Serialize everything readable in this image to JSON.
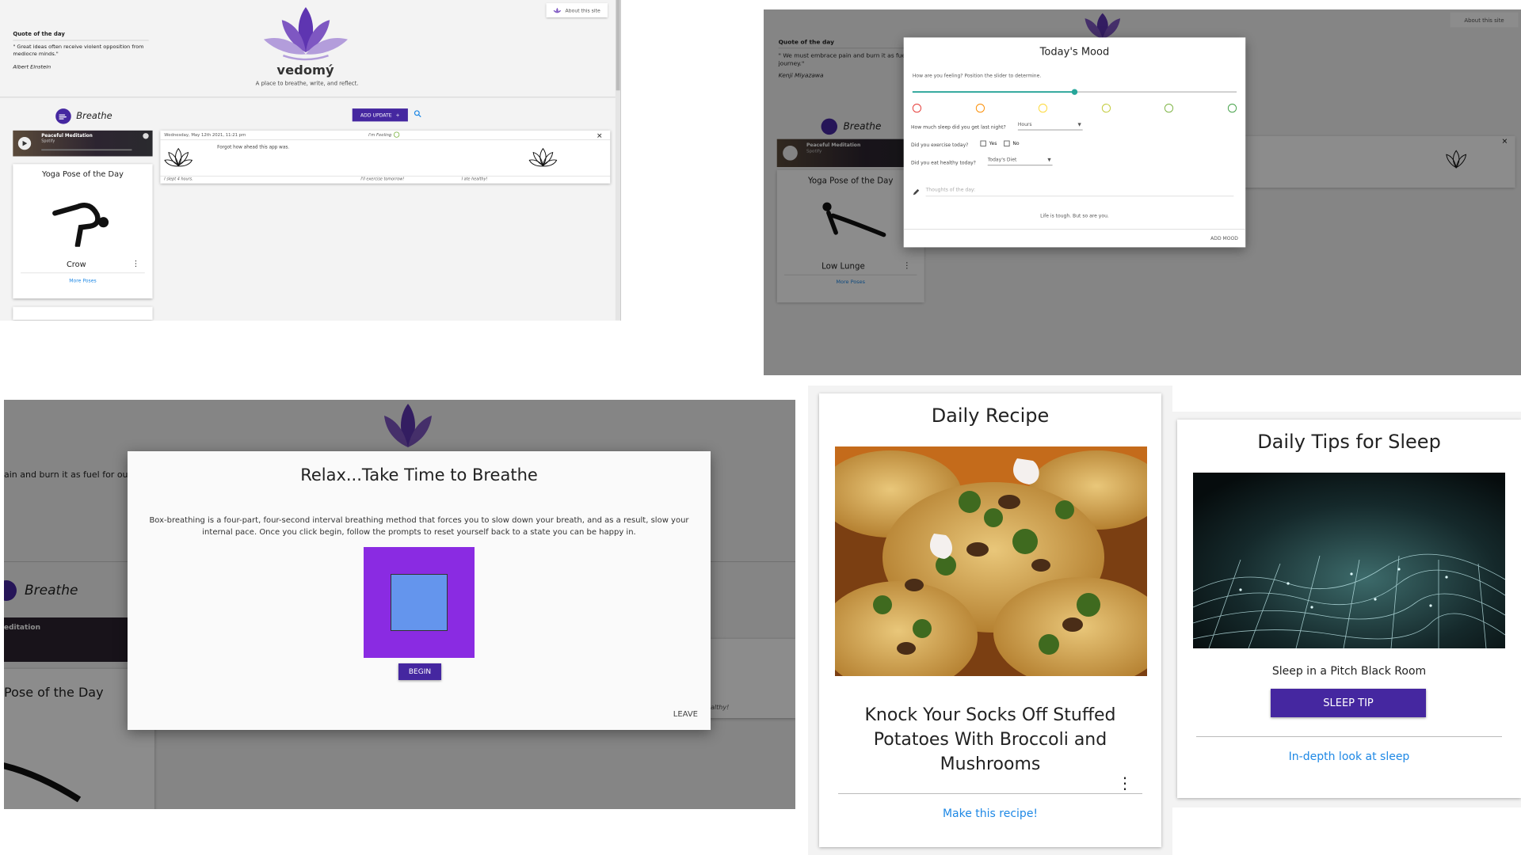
{
  "app": {
    "site_name": "vedomý",
    "tagline": "A place to breathe, write, and reflect.",
    "about_label": "About this site"
  },
  "quote": {
    "title": "Quote of the day",
    "text": "\" Great ideas often receive violent opposition from mediocre minds.\"",
    "author": "Albert Einstein"
  },
  "quote2": {
    "title": "Quote of the day",
    "text": "\" We must embrace pain and burn it as fuel for our journey.\"",
    "author": "Kenji Miyazawa"
  },
  "breathe": {
    "label": "Breathe"
  },
  "toolbar": {
    "add_update_label": "ADD UPDATE"
  },
  "player": {
    "title": "Peaceful Meditation",
    "source": "Spotify"
  },
  "yoga1": {
    "title": "Yoga Pose of the Day",
    "pose": "Crow",
    "link": "More Poses"
  },
  "yoga2": {
    "title": "Yoga Pose of the Day",
    "pose": "Low Lunge",
    "link": "More Poses"
  },
  "entry": {
    "date": "Wednesday, May 12th 2021, 11:21 pm",
    "feeling_label": "I'm Feeling",
    "text": "Forgot how ahead this app was.",
    "slept": "I slept 4 hours.",
    "exercise": "I'll exercise tomorrow!",
    "healthy": "I ate healthy!"
  },
  "mood_modal": {
    "title": "Today's Mood",
    "slider_prompt": "How are you feeling? Position the slider to determine.",
    "slider_value": 0.5,
    "sleep_question": "How much sleep did you get last night?",
    "sleep_value": "Hours",
    "exercise_question": "Did you exercise today?",
    "exercise_yes": "Yes",
    "exercise_no": "No",
    "diet_question": "Did you eat healthy today?",
    "diet_value": "Today's Diet",
    "thoughts_placeholder": "Thoughts of the day:",
    "footer_text": "Life is tough. But so are you.",
    "add_mood_label": "ADD MOOD",
    "face_colors": [
      "#e53935",
      "#fb8c00",
      "#fdd835",
      "#c0ca33",
      "#7cb342",
      "#43a047"
    ]
  },
  "breathe_modal": {
    "title": "Relax...Take Time to Breathe",
    "description": "Box-breathing is a four-part, four-second interval breathing method that forces you to slow down your breath, and as a result, slow your internal pace. Once you click begin, follow the prompts to reset yourself back to a state you can be happy in.",
    "begin_label": "BEGIN",
    "leave_label": "LEAVE",
    "bg_fragment_quote": "ain and burn it as fuel for our",
    "bg_fragment_breathe": "Breathe",
    "bg_fragment_player": "editation",
    "bg_fragment_yoga": "Pose of the Day",
    "bg_fragment_healthy": "althy!"
  },
  "recipe": {
    "heading": "Daily Recipe",
    "title": "Knock Your Socks Off Stuffed Potatoes With Broccoli and Mushrooms",
    "link": "Make this recipe!"
  },
  "sleep": {
    "heading": "Daily Tips for Sleep",
    "tip": "Sleep in a Pitch Black Room",
    "button": "SLEEP TIP",
    "link": "In-depth look at sleep"
  },
  "colors": {
    "brand_purple": "#4527a0",
    "lotus_dark": "#5e35b1",
    "lotus_light": "#9575cd",
    "link_blue": "#1e88e5"
  }
}
